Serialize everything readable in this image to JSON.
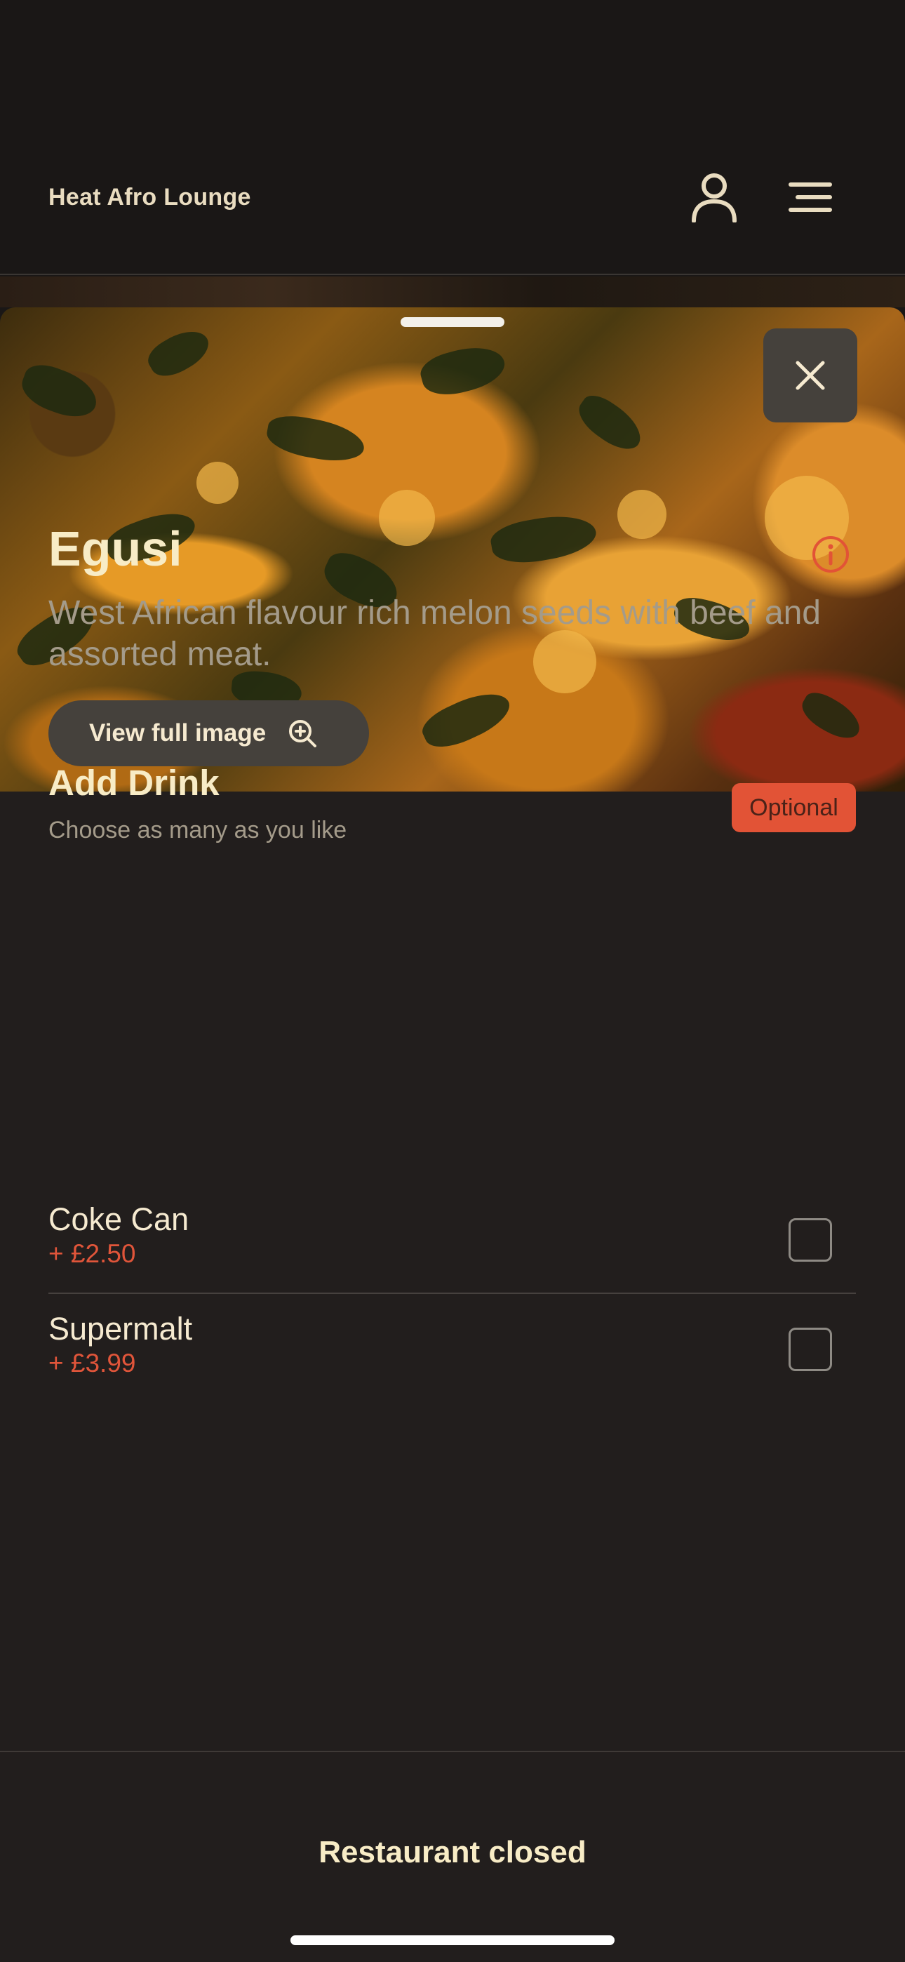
{
  "header": {
    "brand": "Heat Afro Lounge",
    "user_icon": "user-icon",
    "menu_icon": "menu-icon"
  },
  "sheet": {
    "image_alt": "Egusi dish photo",
    "close_icon": "close-icon",
    "view_full_image_label": "View full image",
    "zoom_icon": "zoom-in-icon"
  },
  "item": {
    "name": "Egusi",
    "description": "West African flavour rich melon seeds with beef and assorted meat.",
    "info_icon": "info-icon"
  },
  "modifier_group": {
    "title": "Add Drink",
    "subtitle": "Choose as many as you like",
    "badge": "Optional",
    "options": [
      {
        "name": "Coke Can",
        "price": "+ £2.50",
        "checked": false
      },
      {
        "name": "Supermalt",
        "price": "+ £3.99",
        "checked": false
      }
    ]
  },
  "footer": {
    "status_button": "Restaurant closed"
  },
  "colors": {
    "background": "#221e1d",
    "accent": "#e25336",
    "text_primary": "#f8ecc6",
    "text_secondary": "#a49b8a"
  }
}
